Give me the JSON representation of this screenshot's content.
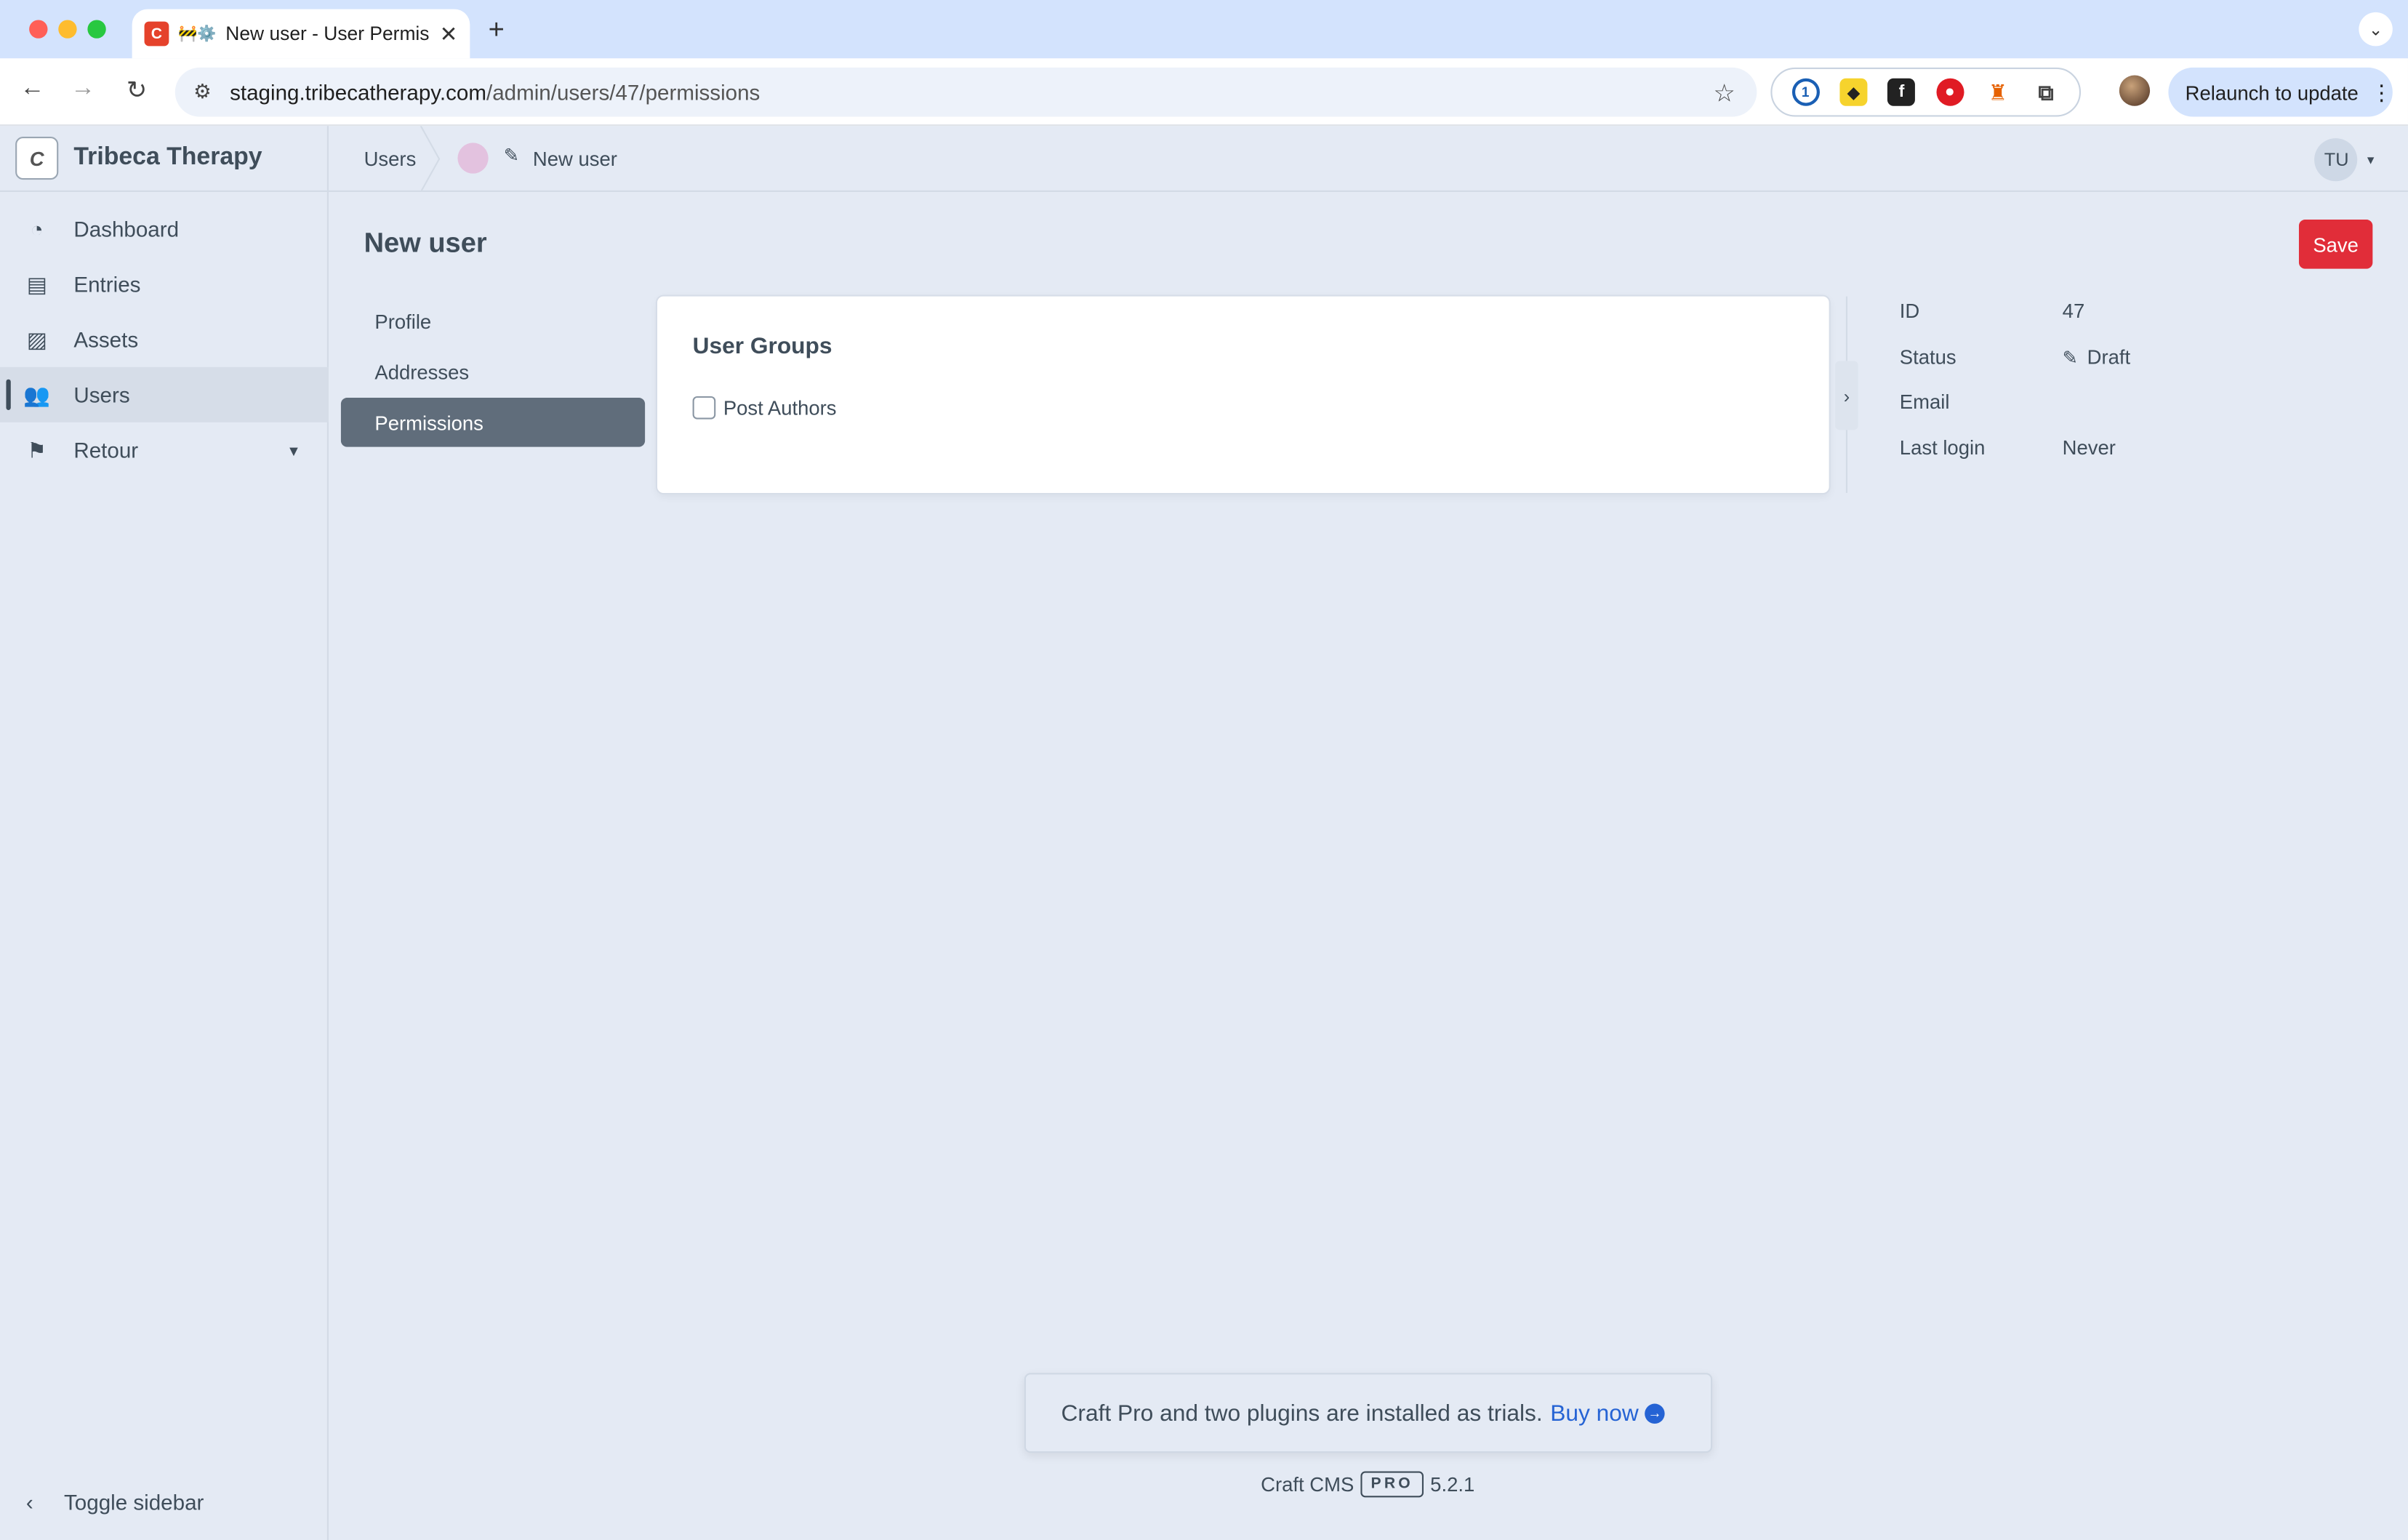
{
  "browser": {
    "tab_title": "New user - User Permis",
    "tab_emoji": "🚧⚙️",
    "tab_favicon_letter": "C",
    "url_host": "staging.tribecatherapy.com",
    "url_path": "/admin/users/47/permissions",
    "relaunch_label": "Relaunch to update"
  },
  "sidebar": {
    "site_logo": "C",
    "site_name": "Tribeca Therapy",
    "items": [
      {
        "label": "Dashboard",
        "icon": "gauge-icon"
      },
      {
        "label": "Entries",
        "icon": "newspaper-icon"
      },
      {
        "label": "Assets",
        "icon": "image-icon"
      },
      {
        "label": "Users",
        "icon": "users-icon"
      },
      {
        "label": "Retour",
        "icon": "signpost-icon"
      }
    ],
    "active_item": "Users",
    "toggle_label": "Toggle sidebar"
  },
  "breadcrumb": {
    "parent": "Users",
    "current": "New user"
  },
  "user_menu": {
    "initials": "TU"
  },
  "page": {
    "title": "New user",
    "save_label": "Save"
  },
  "subnav": {
    "items": [
      "Profile",
      "Addresses",
      "Permissions"
    ],
    "active": "Permissions"
  },
  "user_groups": {
    "heading": "User Groups",
    "options": [
      {
        "label": "Post Authors",
        "checked": false
      }
    ]
  },
  "meta": {
    "id_label": "ID",
    "id_value": "47",
    "status_label": "Status",
    "status_value": "Draft",
    "email_label": "Email",
    "email_value": "",
    "last_login_label": "Last login",
    "last_login_value": "Never"
  },
  "trial": {
    "message": "Craft Pro and two plugins are installed as trials.",
    "buy_label": "Buy now"
  },
  "footer": {
    "product": "Craft CMS",
    "edition": "PRO",
    "version": "5.2.1"
  },
  "colors": {
    "save_button": "#e12d39",
    "active_subnav": "#606d7b",
    "link": "#2563d4",
    "background": "#e4eaf4"
  }
}
